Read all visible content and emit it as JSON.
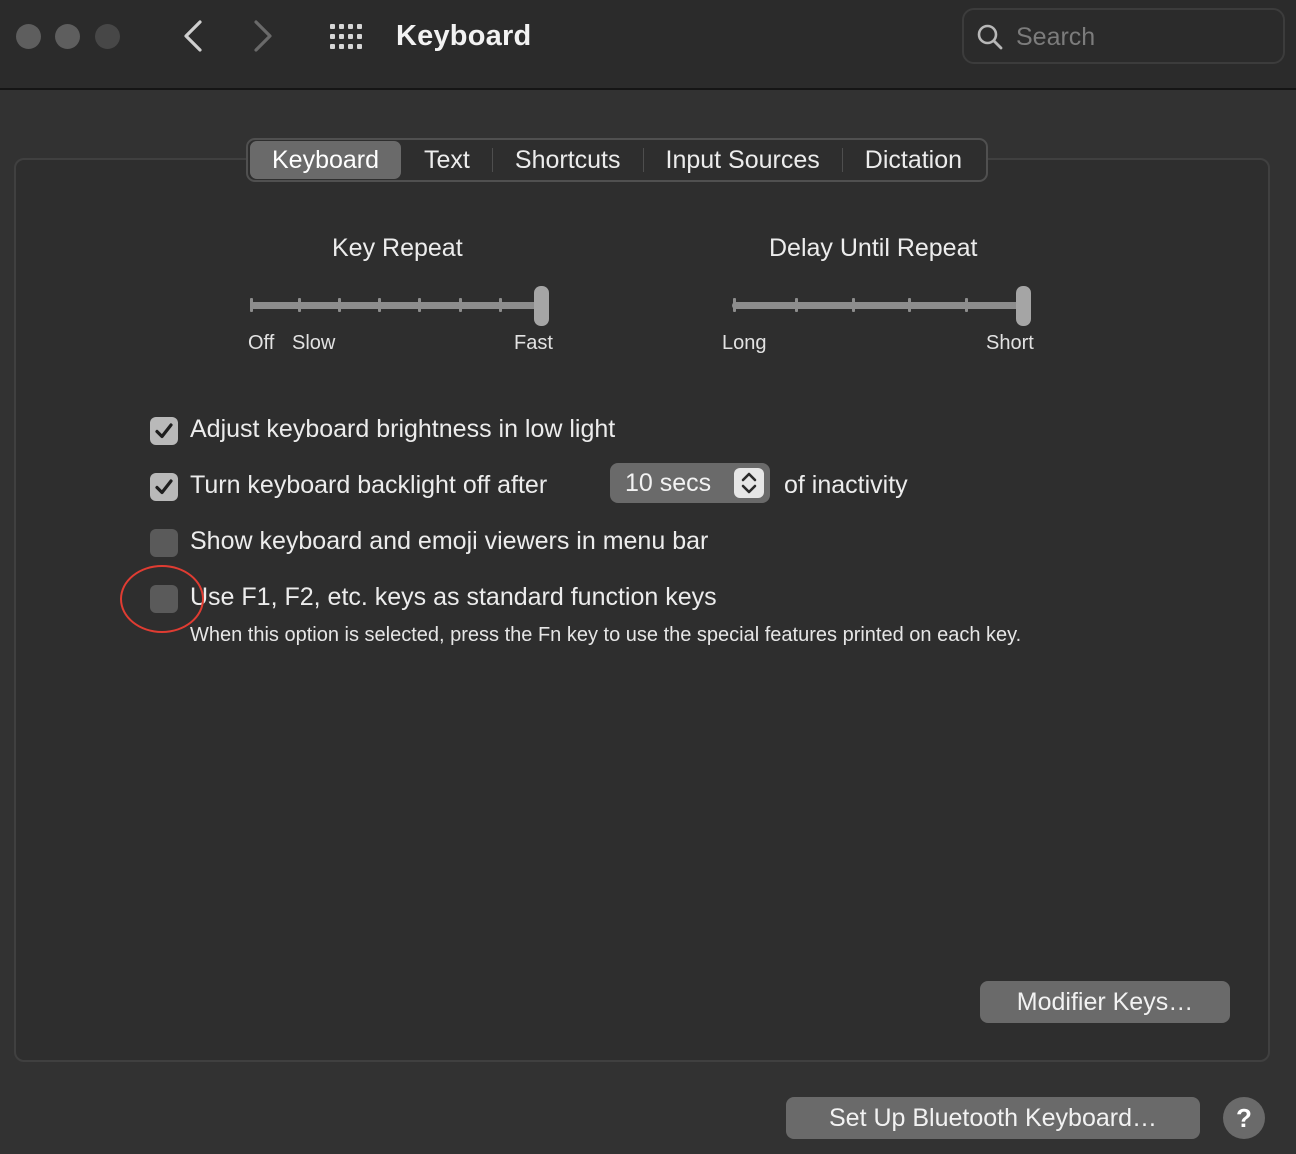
{
  "window": {
    "title": "Keyboard",
    "icons": {
      "back": "chevron-left-icon",
      "forward": "chevron-right-icon",
      "grid": "grid-icon",
      "search": "search-icon"
    }
  },
  "search": {
    "placeholder": "Search",
    "value": ""
  },
  "tabs": [
    {
      "label": "Keyboard",
      "selected": true
    },
    {
      "label": "Text",
      "selected": false
    },
    {
      "label": "Shortcuts",
      "selected": false
    },
    {
      "label": "Input Sources",
      "selected": false
    },
    {
      "label": "Dictation",
      "selected": false
    }
  ],
  "sliders": {
    "key_repeat": {
      "title": "Key Repeat",
      "labels": {
        "off": "Off",
        "slow": "Slow",
        "fast": "Fast"
      },
      "position": 8,
      "max": 8
    },
    "delay_until_repeat": {
      "title": "Delay Until Repeat",
      "labels": {
        "long": "Long",
        "short": "Short"
      },
      "position": 5,
      "max": 5
    }
  },
  "options": {
    "brightness": {
      "label": "Adjust keyboard brightness in low light",
      "checked": true
    },
    "backlight": {
      "label": "Turn keyboard backlight off after",
      "checked": true,
      "popup_value": "10 secs",
      "suffix": "of inactivity"
    },
    "viewers": {
      "label": "Show keyboard and emoji viewers in menu bar",
      "checked": false
    },
    "fn_keys": {
      "label": "Use F1, F2, etc. keys as standard function keys",
      "checked": false,
      "note": "When this option is selected, press the Fn key to use the special features printed on each key."
    }
  },
  "buttons": {
    "modifier_keys": "Modifier Keys…",
    "bluetooth": "Set Up Bluetooth Keyboard…",
    "help": "?"
  },
  "colors": {
    "window_bg": "#323232",
    "toolbar_bg": "#2b2b2b",
    "button_bg": "#6a6a6a",
    "annotation": "#e03c32"
  }
}
